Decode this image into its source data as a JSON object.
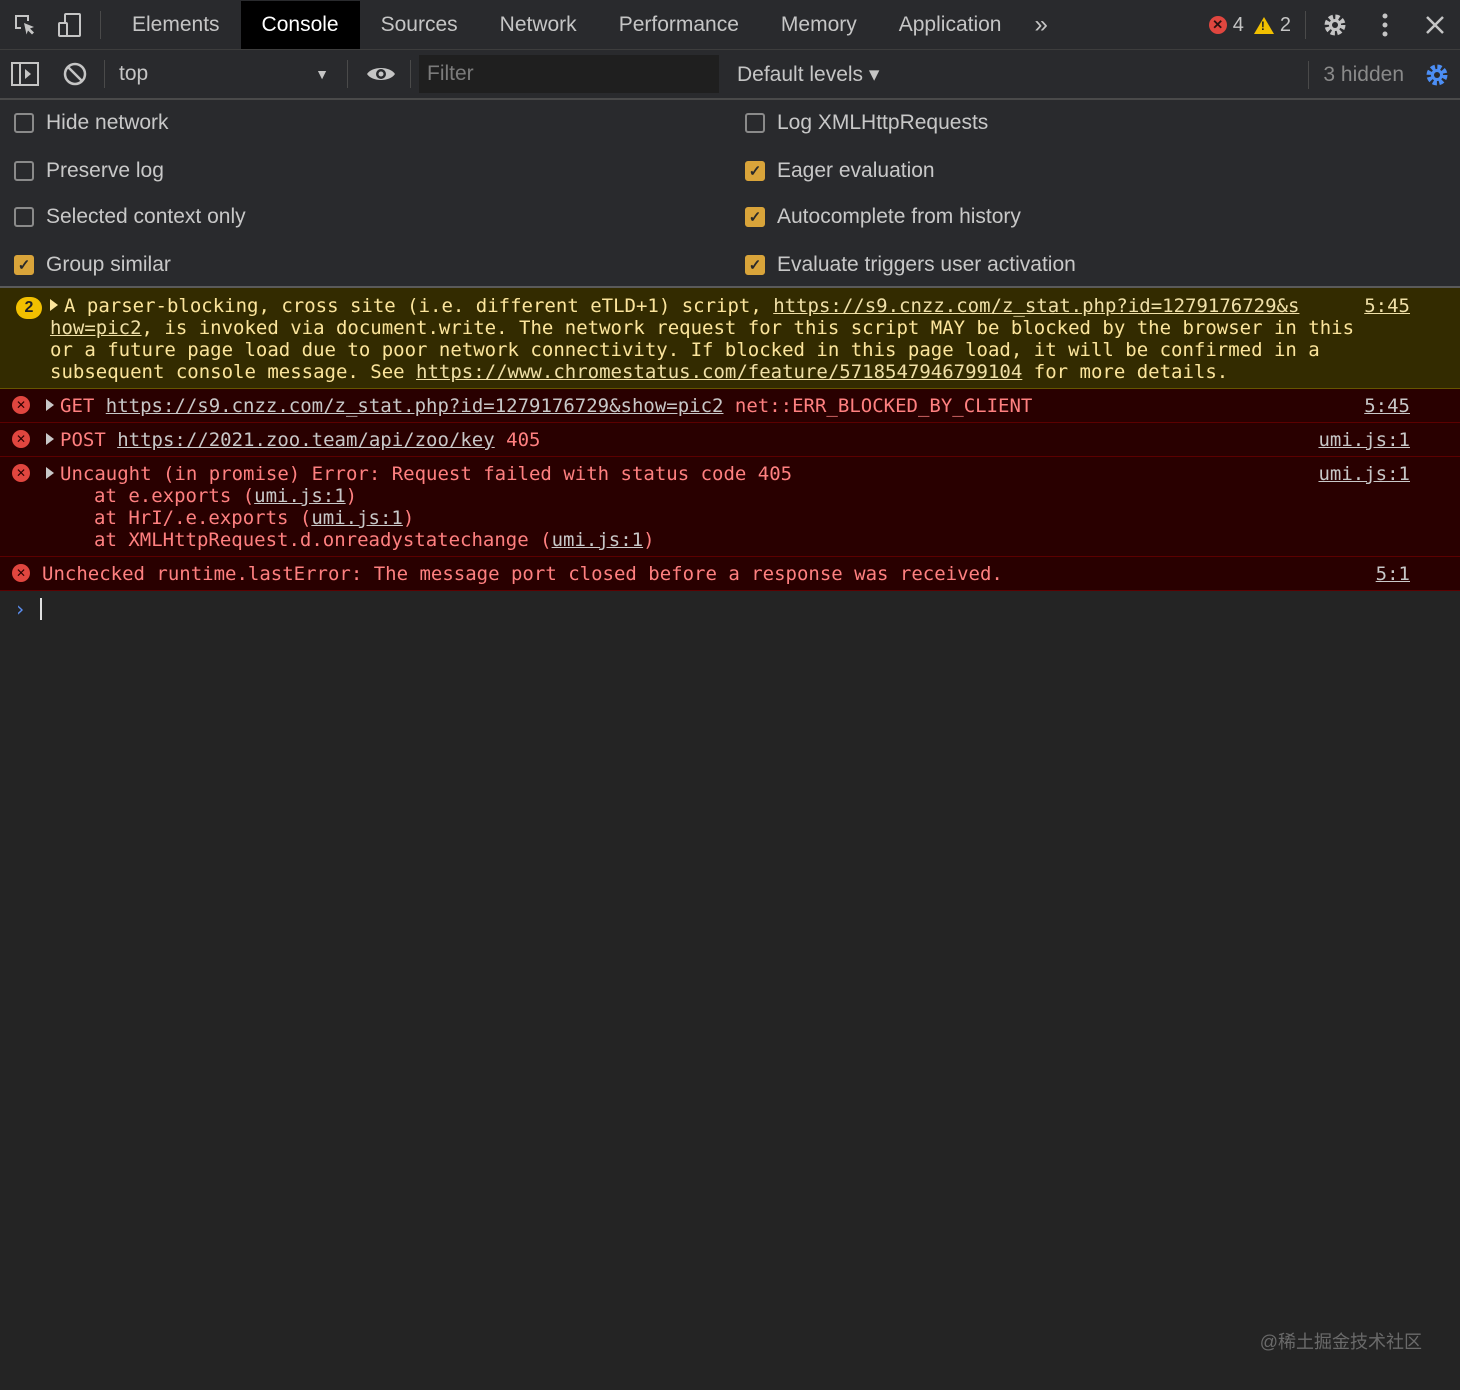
{
  "tabs": [
    "Elements",
    "Console",
    "Sources",
    "Network",
    "Performance",
    "Memory",
    "Application"
  ],
  "more_tabs": "»",
  "counts": {
    "errors": "4",
    "warnings": "2"
  },
  "toolbar": {
    "context": "top",
    "filter_placeholder": "Filter",
    "levels": "Default levels ▾",
    "hidden": "3 hidden"
  },
  "settings": {
    "left": [
      {
        "label": "Hide network",
        "checked": false
      },
      {
        "label": "Preserve log",
        "checked": false
      },
      {
        "label": "Selected context only",
        "checked": false
      },
      {
        "label": "Group similar",
        "checked": true
      }
    ],
    "right": [
      {
        "label": "Log XMLHttpRequests",
        "checked": false
      },
      {
        "label": "Eager evaluation",
        "checked": true
      },
      {
        "label": "Autocomplete from history",
        "checked": true
      },
      {
        "label": "Evaluate triggers user activation",
        "checked": true
      }
    ]
  },
  "warning": {
    "count": "2",
    "line1_text": "A parser-blocking, cross site (i.e. different eTLD+1) script, ",
    "line1_link": "https://s9.cnzz.com/z_stat.php?id=1279176729&s",
    "source": "5:45",
    "line2_link": "how=pic2",
    "line2_text": ", is invoked via document.write. The network request for this script MAY be blocked by the browser in this",
    "line3_text": "or a future page load due to poor network connectivity. If blocked in this page load, it will be confirmed in a",
    "line4_text": "subsequent console message. See ",
    "line4_link": "https://www.chromestatus.com/feature/5718547946799104",
    "line4_tail": " for more details."
  },
  "errors": {
    "get": {
      "method": "GET ",
      "url": "https://s9.cnzz.com/z_stat.php?id=1279176729&show=pic2",
      "tail": " net::ERR_BLOCKED_BY_CLIENT",
      "source": "5:45"
    },
    "post": {
      "method": "POST ",
      "url": "https://2021.zoo.team/api/zoo/key",
      "tail": " 405",
      "source": "umi.js:1"
    },
    "uncaught": {
      "text": "Uncaught (in promise) Error: Request failed with status code 405",
      "source": "umi.js:1",
      "stack1_pre": "at e.exports (",
      "stack1_link": "umi.js:1",
      "stack1_post": ")",
      "stack2_pre": "at HrI/.e.exports (",
      "stack2_link": "umi.js:1",
      "stack2_post": ")",
      "stack3_pre": "at XMLHttpRequest.d.onreadystatechange (",
      "stack3_link": "umi.js:1",
      "stack3_post": ")"
    },
    "runtime": {
      "text": "Unchecked runtime.lastError: The message port closed before a response was received.",
      "source": "5:1"
    }
  },
  "prompt": "›",
  "watermark": "@稀土掘金技术社区"
}
